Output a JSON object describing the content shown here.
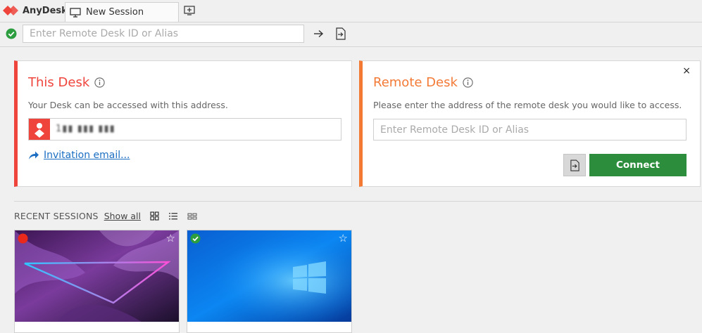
{
  "app": {
    "name": "AnyDesk"
  },
  "tabs": [
    {
      "label": "New Session"
    }
  ],
  "address_bar": {
    "placeholder": "Enter Remote Desk ID or Alias"
  },
  "this_desk": {
    "title": "This Desk",
    "description": "Your Desk can be accessed with this address.",
    "desk_id": "1▮▮ ▮▮▮ ▮▮▮",
    "invite_label": "Invitation email..."
  },
  "remote_desk": {
    "title": "Remote Desk",
    "description": "Please enter the address of the remote desk you would like to access.",
    "placeholder": "Enter Remote Desk ID or Alias",
    "connect_label": "Connect",
    "close_label": "×"
  },
  "recent": {
    "label": "RECENT SESSIONS",
    "show_all": "Show all",
    "sessions": [
      {
        "status": "offline",
        "favorite_glyph": "☆"
      },
      {
        "status": "online",
        "favorite_glyph": "☆"
      }
    ]
  },
  "colors": {
    "accent_red": "#ef443b",
    "accent_orange": "#f37a35",
    "connect_green": "#2c8e3d",
    "link_blue": "#1b6ec2"
  }
}
